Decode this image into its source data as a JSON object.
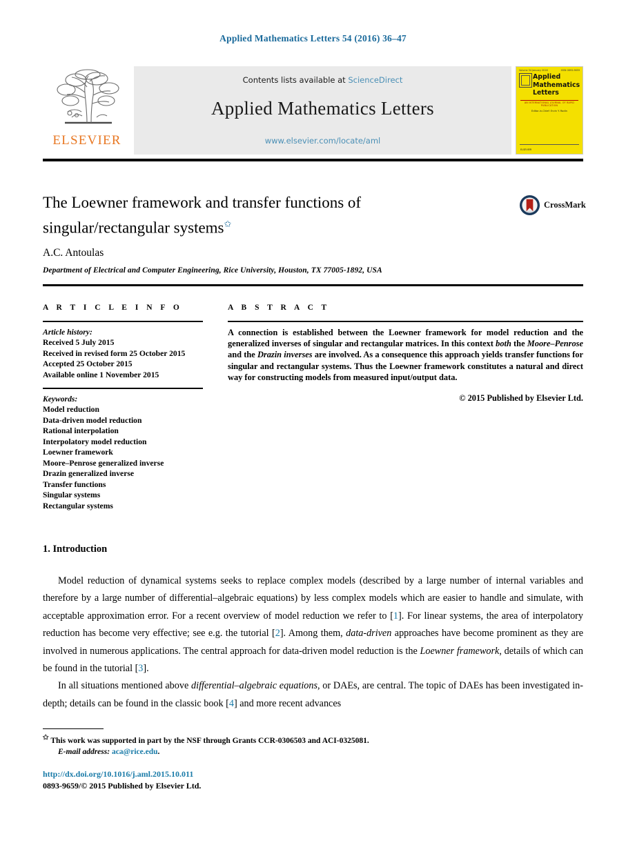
{
  "running_head": "Applied Mathematics Letters 54 (2016) 36–47",
  "masthead": {
    "publisher_name": "ELSEVIER",
    "contents_prefix": "Contents lists available at ",
    "contents_link": "ScienceDirect",
    "journal_name": "Applied Mathematics Letters",
    "journal_url": "www.elsevier.com/locate/aml",
    "cover": {
      "volume_line": "Volume 54  January 2016",
      "issn_line": "ISSN 0893-9659",
      "title_line1": "Applied",
      "title_line2": "Mathematics",
      "title_line3": "Letters",
      "subtitle": "AN INTERNATIONAL JOURNAL OF RAPID PUBLICATION",
      "editor": "Editor-in-Chief: Ervin Y. Rodin",
      "foot": "ELSEVIER"
    }
  },
  "article": {
    "title": "The Loewner framework and transfer functions of singular/rectangular systems",
    "title_footnote_marker": "✩",
    "crossmark_label": "CrossMark",
    "author": "A.C. Antoulas",
    "affiliation": "Department of Electrical and Computer Engineering, Rice University, Houston, TX 77005-1892, USA"
  },
  "info": {
    "heading": "A R T I C L E   I N F O",
    "history_label": "Article history:",
    "history": [
      "Received 5 July 2015",
      "Received in revised form 25 October 2015",
      "Accepted 25 October 2015",
      "Available online 1 November 2015"
    ],
    "keywords_label": "Keywords:",
    "keywords": [
      "Model reduction",
      "Data-driven model reduction",
      "Rational interpolation",
      "Interpolatory model reduction",
      "Loewner framework",
      "Moore–Penrose generalized inverse",
      "Drazin generalized inverse",
      "Transfer functions",
      "Singular systems",
      "Rectangular systems"
    ]
  },
  "abstract": {
    "heading": "A B S T R A C T",
    "p1_a": "A connection is established between the Loewner framework for model reduction and the generalized inverses of singular and rectangular matrices. In this context ",
    "p1_both": "both",
    "p1_b": " the ",
    "p1_mp": "Moore–Penrose",
    "p1_c": " and the ",
    "p1_drazin": "Drazin inverses",
    "p1_d": " are involved. As a consequence this approach yields transfer functions for singular and rectangular systems. Thus the Loewner framework constitutes a natural and direct way for constructing models from measured input/output data.",
    "copyright": "© 2015 Published by Elsevier Ltd."
  },
  "body": {
    "section_heading": "1. Introduction",
    "p1_a": "Model reduction of dynamical systems seeks to replace complex models (described by a large number of internal variables and therefore by a large number of differential–algebraic equations) by less complex models which are easier to handle and simulate, with acceptable approximation error. For a recent overview of model reduction we refer to [",
    "p1_cite1": "1",
    "p1_b": "]. For linear systems, the area of interpolatory reduction has become very effective; see e.g. the tutorial [",
    "p1_cite2": "2",
    "p1_c": "]. Among them, ",
    "p1_dd": "data-driven",
    "p1_d": " approaches have become prominent as they are involved in numerous applications. The central approach for data-driven model reduction is the ",
    "p1_lf": "Loewner framework",
    "p1_e": ", details of which can be found in the tutorial [",
    "p1_cite3": "3",
    "p1_f": "].",
    "p2_a": "In all situations mentioned above ",
    "p2_dae": "differential–algebraic equations",
    "p2_b": ", or DAEs, are central. The topic of DAEs has been investigated in-depth; details can be found in the classic book [",
    "p2_cite4": "4",
    "p2_c": "] and more recent advances"
  },
  "footnote": {
    "marker": "✩",
    "text": "This work was supported in part by the NSF through Grants CCR-0306503 and ACI-0325081.",
    "email_label": "E-mail address:",
    "email": "aca@rice.edu",
    "email_period": "."
  },
  "footer": {
    "doi": "http://dx.doi.org/10.1016/j.aml.2015.10.011",
    "issn_line": "0893-9659/© 2015 Published by Elsevier Ltd."
  },
  "colors": {
    "link_blue": "#1a7ba8",
    "header_blue": "#1a6a9b",
    "sciencedirect_blue": "#4a8fb5",
    "elsevier_orange": "#E87722",
    "cover_yellow": "#f4e000",
    "masthead_gray": "#eaeaea"
  }
}
